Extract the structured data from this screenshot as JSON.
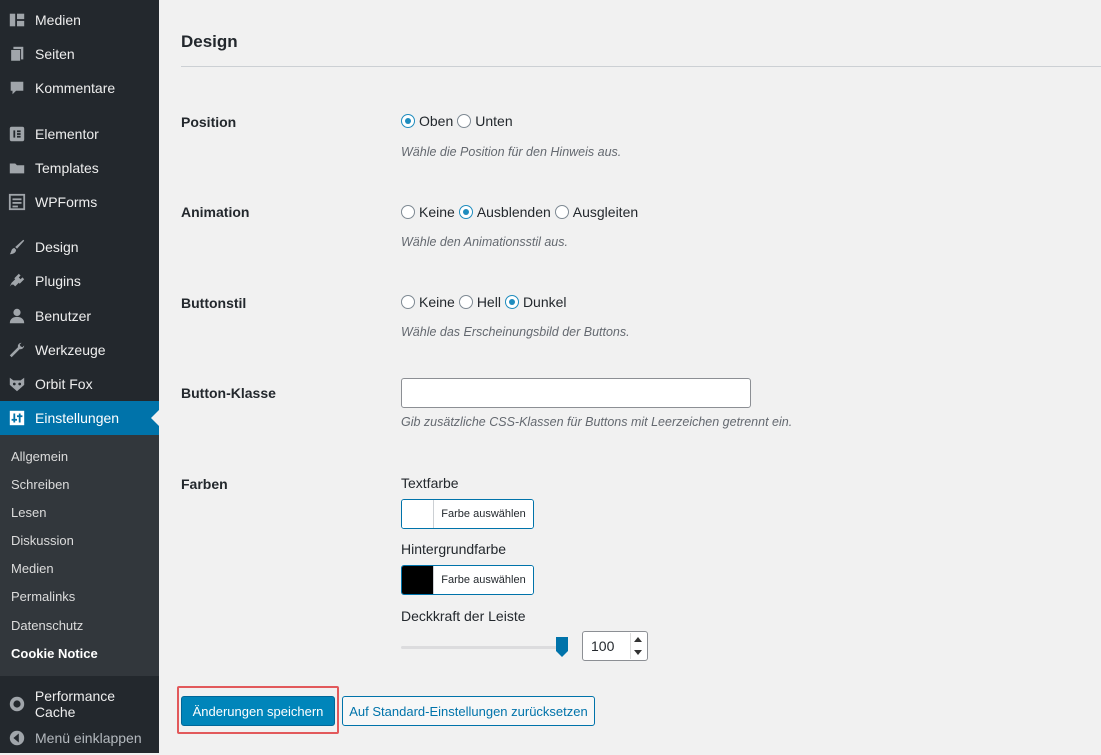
{
  "sidebar": {
    "items": [
      {
        "label": "Medien",
        "icon": "media-icon"
      },
      {
        "label": "Seiten",
        "icon": "pages-icon"
      },
      {
        "label": "Kommentare",
        "icon": "comments-icon"
      },
      {
        "label": "Elementor",
        "icon": "elementor-icon"
      },
      {
        "label": "Templates",
        "icon": "folder-icon"
      },
      {
        "label": "WPForms",
        "icon": "forms-icon"
      },
      {
        "label": "Design",
        "icon": "brush-icon"
      },
      {
        "label": "Plugins",
        "icon": "plugin-icon"
      },
      {
        "label": "Benutzer",
        "icon": "user-icon"
      },
      {
        "label": "Werkzeuge",
        "icon": "wrench-icon"
      },
      {
        "label": "Orbit Fox",
        "icon": "fox-icon"
      },
      {
        "label": "Einstellungen",
        "icon": "settings-icon",
        "active": true
      }
    ],
    "submenu": [
      "Allgemein",
      "Schreiben",
      "Lesen",
      "Diskussion",
      "Medien",
      "Permalinks",
      "Datenschutz",
      "Cookie Notice"
    ],
    "submenu_current": "Cookie Notice",
    "after_items": [
      {
        "label": "Performance Cache",
        "icon": "performance-icon"
      }
    ],
    "collapse_label": "Menü einklappen",
    "active_color": "#0073aa"
  },
  "content": {
    "section_title": "Design",
    "position": {
      "label": "Position",
      "options": [
        "Oben",
        "Unten"
      ],
      "selected": "Oben",
      "description": "Wähle die Position für den Hinweis aus."
    },
    "animation": {
      "label": "Animation",
      "options": [
        "Keine",
        "Ausblenden",
        "Ausgleiten"
      ],
      "selected": "Ausblenden",
      "description": "Wähle den Animationsstil aus."
    },
    "button_style": {
      "label": "Buttonstil",
      "options": [
        "Keine",
        "Hell",
        "Dunkel"
      ],
      "selected": "Dunkel",
      "description": "Wähle das Erscheinungsbild der Buttons."
    },
    "button_class": {
      "label": "Button-Klasse",
      "value": "",
      "description": "Gib zusätzliche CSS-Klassen für Buttons mit Leerzeichen getrennt ein."
    },
    "colors": {
      "label": "Farben",
      "text_color_label": "Textfarbe",
      "text_color_value": "#ffffff",
      "bg_color_label": "Hintergrundfarbe",
      "bg_color_value": "#000000",
      "picker_label": "Farbe auswählen",
      "opacity_label": "Deckkraft der Leiste",
      "opacity_value": "100",
      "opacity_fraction": 1.0
    },
    "save_label": "Änderungen speichern",
    "reset_label": "Auf Standard-Einstellungen zurücksetzen",
    "highlight_color": "#e2595b"
  }
}
